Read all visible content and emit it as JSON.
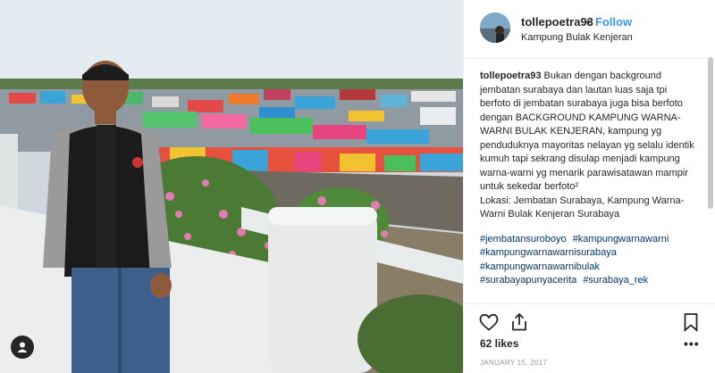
{
  "post": {
    "username": "tollepoetra93",
    "separator": "•",
    "follow_label": "Follow",
    "location": "Kampung Bulak Kenjeran"
  },
  "caption": {
    "username": "tollepoetra93",
    "text": "Bukan dengan background jembatan surabaya dan lautan luas saja tpi berfoto di jembatan surabaya juga bisa berfoto dengan BACKGROUND KAMPUNG WARNA-WARNI BULAK KENJERAN, kampung yg penduduknya mayoritas nelayan yg selalu identik kumuh tapi sekrang disulap menjadi kampung warna-warni yg menarik parawisatawan mampir untuk sekedar berfoto²",
    "location_line": "Lokasi: Jembatan Surabaya, Kampung Warna-Warni Bulak Kenjeran Surabaya",
    "hashtags": [
      "#jembatansuroboyo",
      "#kampungwarnawarni",
      "#kampungwarnawarnisurabaya",
      "#kampungwarnawarnibulak",
      "#surabayapunyacerita",
      "#surabaya_rek"
    ]
  },
  "footer": {
    "likes": "62 likes",
    "more": "•••",
    "date": "JANUARY 15, 2017"
  },
  "icons": {
    "like": "heart-icon",
    "share": "share-icon",
    "save": "bookmark-icon",
    "user_tag": "user-tag-icon"
  }
}
